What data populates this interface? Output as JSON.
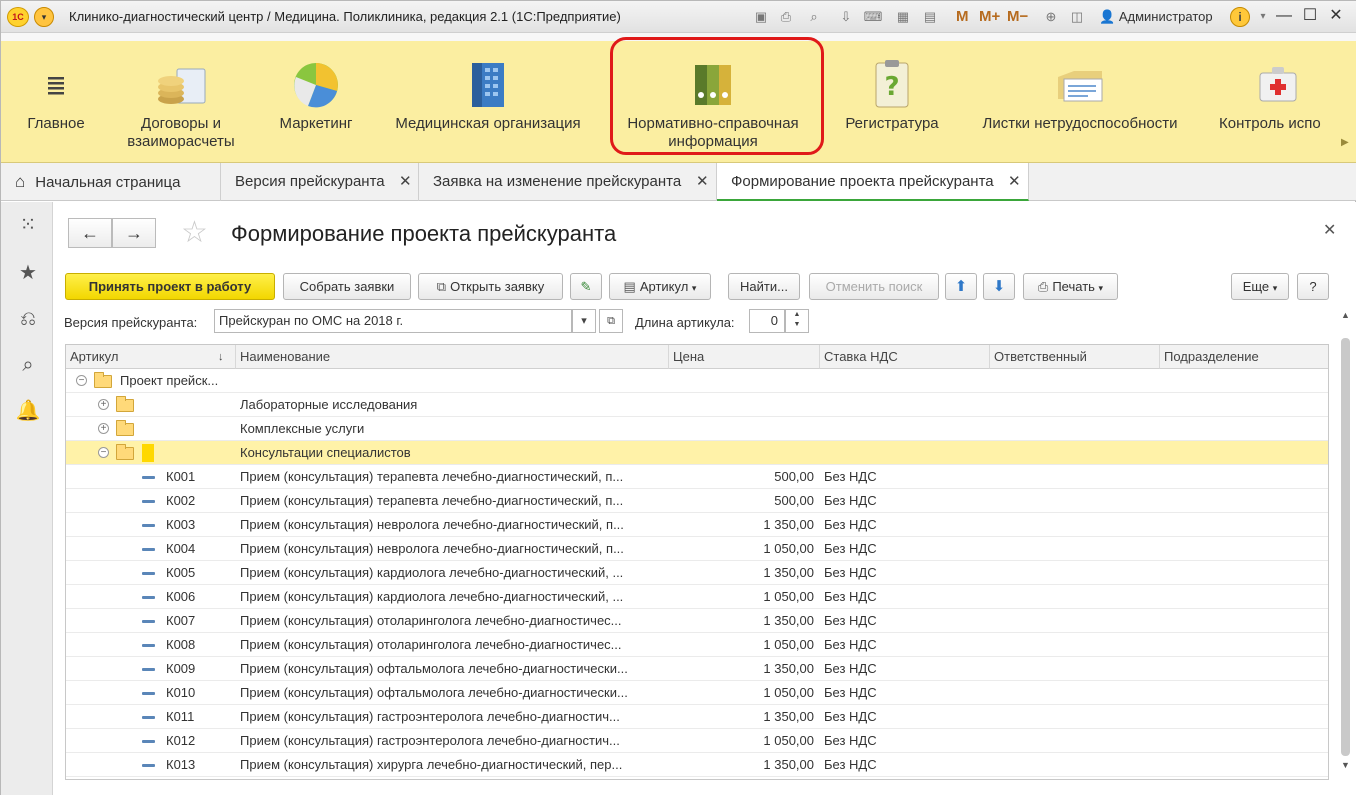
{
  "window": {
    "logo": "1С",
    "title": "Клинико-диагностический центр / Медицина. Поликлиника, редакция 2.1  (1С:Предприятие)",
    "user": "Администратор",
    "m_buttons": [
      "M",
      "M+",
      "M−"
    ]
  },
  "sections": {
    "items": [
      {
        "label": "Главное",
        "icon": "menu-lines-icon"
      },
      {
        "label": "Договоры и\nвзаиморасчеты",
        "icon": "coins-icon"
      },
      {
        "label": "Маркетинг",
        "icon": "pie-chart-icon"
      },
      {
        "label": "Медицинская организация",
        "icon": "building-icon"
      },
      {
        "label": "Нормативно-справочная\nинформация",
        "icon": "binders-icon"
      },
      {
        "label": "Регистратура",
        "icon": "clipboard-question-icon"
      },
      {
        "label": "Листки нетрудоспособности",
        "icon": "folder-documents-icon"
      },
      {
        "label": "Контроль испо",
        "icon": "first-aid-kit-icon"
      }
    ],
    "highlight_color": "#e01919"
  },
  "tabs": [
    {
      "label": "Начальная страница",
      "closable": false
    },
    {
      "label": "Версия прейскуранта",
      "closable": true
    },
    {
      "label": "Заявка на изменение прейскуранта",
      "closable": true
    },
    {
      "label": "Формирование проекта прейскуранта",
      "closable": true,
      "active": true
    }
  ],
  "form": {
    "title": "Формирование проекта прейскуранта",
    "toolbar": {
      "accept": "Принять проект в работу",
      "collect": "Собрать заявки",
      "open": "Открыть заявку",
      "article": "Артикул",
      "find": "Найти...",
      "cancel_search": "Отменить поиск",
      "print": "Печать",
      "more": "Еще",
      "help": "?"
    },
    "version_label": "Версия прейскуранта:",
    "version_value": "Прейскуран по ОМС на 2018 г.",
    "length_label": "Длина артикула:",
    "length_value": "0"
  },
  "grid": {
    "columns": [
      "Артикул",
      "Наименование",
      "Цена",
      "Ставка НДС",
      "Ответственный",
      "Подразделение"
    ],
    "groups": [
      {
        "label": "Проект прейск...",
        "level": 0,
        "expanded": true
      },
      {
        "label": "Лабораторные исследования",
        "level": 1,
        "expanded": false
      },
      {
        "label": "Комплексные услуги",
        "level": 1,
        "expanded": false
      },
      {
        "label": "Консультации специалистов",
        "level": 1,
        "expanded": true,
        "selected": true
      }
    ],
    "rows": [
      {
        "code": "К001",
        "name": "Прием (консультация) терапевта лечебно-диагностический, п...",
        "price": "500,00",
        "vat": "Без НДС"
      },
      {
        "code": "К002",
        "name": "Прием (консультация) терапевта лечебно-диагностический, п...",
        "price": "500,00",
        "vat": "Без НДС"
      },
      {
        "code": "К003",
        "name": "Прием (консультация) невролога лечебно-диагностический, п...",
        "price": "1 350,00",
        "vat": "Без НДС"
      },
      {
        "code": "К004",
        "name": "Прием (консультация) невролога лечебно-диагностический, п...",
        "price": "1 050,00",
        "vat": "Без НДС"
      },
      {
        "code": "К005",
        "name": "Прием (консультация) кардиолога лечебно-диагностический, ...",
        "price": "1 350,00",
        "vat": "Без НДС"
      },
      {
        "code": "К006",
        "name": "Прием (консультация) кардиолога лечебно-диагностический, ...",
        "price": "1 050,00",
        "vat": "Без НДС"
      },
      {
        "code": "К007",
        "name": "Прием (консультация) отоларинголога лечебно-диагностичес...",
        "price": "1 350,00",
        "vat": "Без НДС"
      },
      {
        "code": "К008",
        "name": "Прием (консультация) отоларинголога лечебно-диагностичес...",
        "price": "1 050,00",
        "vat": "Без НДС"
      },
      {
        "code": "К009",
        "name": "Прием (консультация) офтальмолога лечебно-диагностически...",
        "price": "1 350,00",
        "vat": "Без НДС"
      },
      {
        "code": "К010",
        "name": "Прием (консультация) офтальмолога лечебно-диагностически...",
        "price": "1 050,00",
        "vat": "Без НДС"
      },
      {
        "code": "К011",
        "name": "Прием (консультация) гастроэнтеролога лечебно-диагностич...",
        "price": "1 350,00",
        "vat": "Без НДС"
      },
      {
        "code": "К012",
        "name": "Прием (консультация) гастроэнтеролога лечебно-диагностич...",
        "price": "1 050,00",
        "vat": "Без НДС"
      },
      {
        "code": "К013",
        "name": "Прием (консультация) хирурга лечебно-диагностический, пер...",
        "price": "1 350,00",
        "vat": "Без НДС"
      }
    ]
  }
}
